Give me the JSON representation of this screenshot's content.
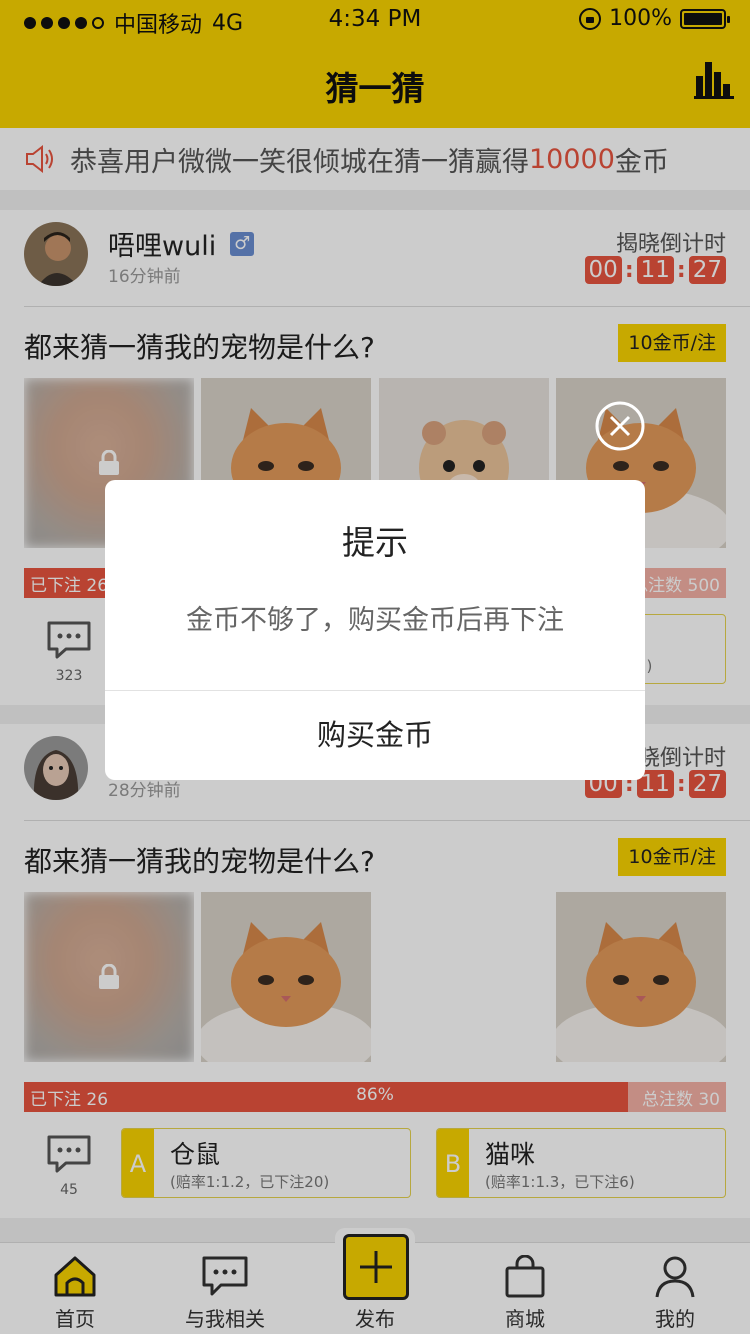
{
  "status_bar": {
    "carrier": "中国移动",
    "network": "4G",
    "time": "4:34 PM",
    "battery": "100%"
  },
  "nav": {
    "title": "猜一猜",
    "chart_icon": "bar-chart-icon"
  },
  "notice": {
    "prefix": "恭喜用户",
    "user": "微微一笑很倾城",
    "middle": "在猜一猜赢得",
    "amount": "10000",
    "suffix": "金币"
  },
  "posts": [
    {
      "username": "唔哩wuli",
      "gender": "♂",
      "time_ago": "16分钟前",
      "countdown_label": "揭晓倒计时",
      "countdown": [
        "00",
        "11",
        "27"
      ],
      "question": "都来猜一猜我的宠物是什么?",
      "price": "10金币/注",
      "photos": [
        "blurred-locked",
        "kitten",
        "hamster",
        "kitten"
      ],
      "bet_label": "已下注 26",
      "total_label": "总注数 500",
      "comments": "323",
      "odds_b": "2)"
    },
    {
      "time_ago": "28分钟前",
      "countdown_label": "晓倒计时",
      "countdown": [
        "00",
        "11",
        "27"
      ],
      "question": "都来猜一猜我的宠物是什么?",
      "price": "10金币/注",
      "photos": [
        "blurred-locked",
        "kitten",
        "kitten"
      ],
      "bet_label": "已下注 26",
      "percent": "86%",
      "percent_value": 0.86,
      "total_label": "总注数 30",
      "comments": "45",
      "options": [
        {
          "letter": "A",
          "name": "仓鼠",
          "odds": "(赔率1:1.2，已下注20)"
        },
        {
          "letter": "B",
          "name": "猫咪",
          "odds": "(赔率1:1.3，已下注6)"
        }
      ]
    }
  ],
  "tabs": [
    {
      "label": "首页",
      "icon": "home-icon"
    },
    {
      "label": "与我相关",
      "icon": "chat-icon"
    },
    {
      "label": "发布",
      "icon": "plus-icon"
    },
    {
      "label": "商城",
      "icon": "bag-icon"
    },
    {
      "label": "我的",
      "icon": "person-icon"
    }
  ],
  "dialog": {
    "title": "提示",
    "message": "金币不够了，购买金币后再下注",
    "button": "购买金币"
  },
  "colors": {
    "brand": "#f9d400",
    "accent": "#e8543f"
  }
}
